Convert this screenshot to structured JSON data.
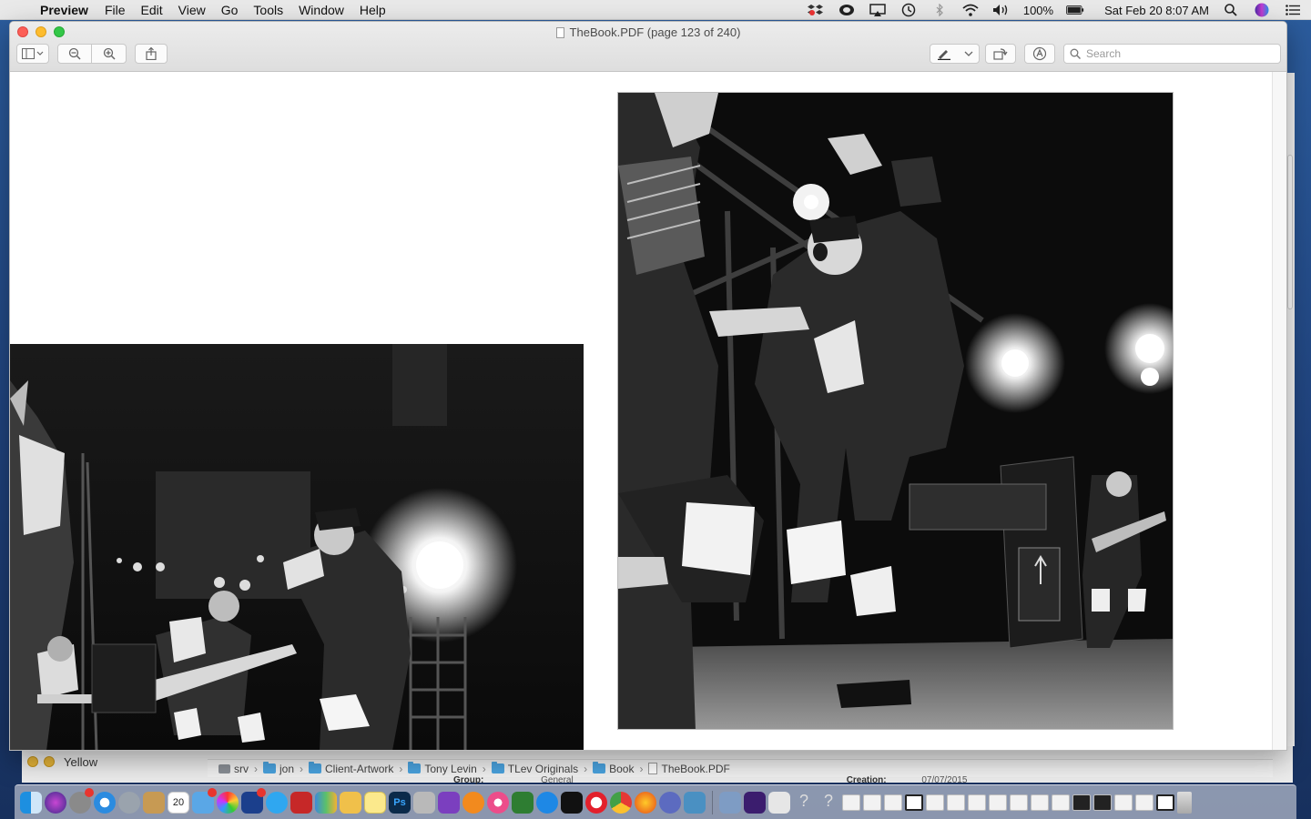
{
  "menubar": {
    "app_name": "Preview",
    "items": [
      "File",
      "Edit",
      "View",
      "Go",
      "Tools",
      "Window",
      "Help"
    ],
    "battery": "100%",
    "clock": "Sat Feb 20  8:07 AM"
  },
  "window": {
    "title": "TheBook.PDF (page 123 of 240)",
    "search_placeholder": "Search"
  },
  "finder_behind": {
    "tag_label": "Yellow",
    "path": [
      "srv",
      "jon",
      "Client-Artwork",
      "Tony Levin",
      "TLev Originals",
      "Book",
      "TheBook.PDF"
    ],
    "meta_group_label": "Group:",
    "meta_group_value": "General",
    "meta_created_label": "Creation:",
    "meta_created_value": "07/07/2015"
  },
  "colors": {
    "tag_yellow": "#e6b53a",
    "folder_blue": "#4aa3df",
    "close_red": "#fc5f57",
    "minimize_yellow": "#fdbc2e",
    "zoom_green": "#33c748"
  },
  "dock": {
    "calendar_day": "20"
  }
}
